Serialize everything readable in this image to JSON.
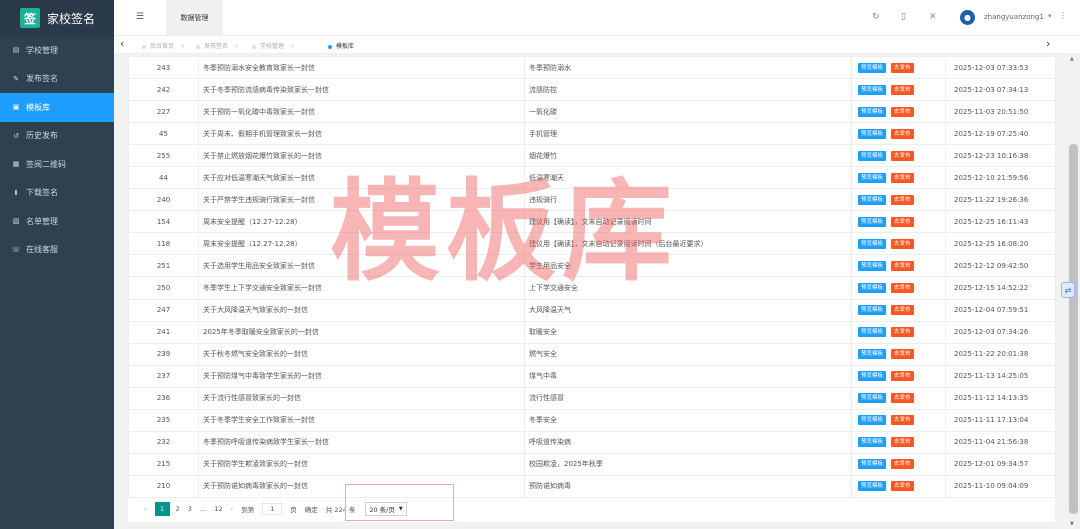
{
  "app": {
    "logo_char": "签",
    "title": "家校签名"
  },
  "sidebar": {
    "items": [
      {
        "label": "学校管理",
        "icon": "document-icon"
      },
      {
        "label": "发布签名",
        "icon": "pencil-icon"
      },
      {
        "label": "模板库",
        "icon": "file-icon",
        "active": true
      },
      {
        "label": "历史发布",
        "icon": "history-icon"
      },
      {
        "label": "签阅二维码",
        "icon": "qrcode-icon"
      },
      {
        "label": "下载签名",
        "icon": "download-icon"
      },
      {
        "label": "名单管理",
        "icon": "contacts-icon"
      },
      {
        "label": "在线客服",
        "icon": "customer-service-icon"
      }
    ]
  },
  "topbar": {
    "top_tab": "数据管理",
    "username": "zhangyuanzong1"
  },
  "tabs": [
    {
      "label": "后台首页"
    },
    {
      "label": "发布签名"
    },
    {
      "label": "学校管理"
    },
    {
      "label": "模板库",
      "current": true
    }
  ],
  "table": {
    "preview_label": "预览模板",
    "publish_label": "去发布",
    "rows": [
      {
        "id": "243",
        "title": "冬季预防溺水安全教育致家长一封信",
        "category": "冬季预防溺水",
        "time": "2025-12-03 07:33:53"
      },
      {
        "id": "242",
        "title": "关于冬季预防流感病毒传染致家长一封信",
        "category": "流感防控",
        "time": "2025-12-03 07:34:13"
      },
      {
        "id": "227",
        "title": "关于预防一氧化碳中毒致家长一封信",
        "category": "一氧化碳",
        "time": "2025-11-03 20:51:50"
      },
      {
        "id": "45",
        "title": "关于周末、假期手机管理致家长一封信",
        "category": "手机管理",
        "time": "2025-12-19 07:25:40"
      },
      {
        "id": "255",
        "title": "关于禁止燃放烟花爆竹致家长的一封信",
        "category": "烟花爆竹",
        "time": "2025-12-23 10:16:38"
      },
      {
        "id": "44",
        "title": "关于应对低温寒潮天气致家长一封信",
        "category": "低温寒潮天",
        "time": "2025-12-10 21:59:56"
      },
      {
        "id": "240",
        "title": "关于严禁学生违规骑行致家长一封信",
        "category": "违规骑行",
        "time": "2025-11-22 19:26:36"
      },
      {
        "id": "154",
        "title": "周末安全提醒（12.27-12.28）",
        "category": "建议用【确读】，文末自动记录阅读时间",
        "time": "2025-12-25 16:11:43"
      },
      {
        "id": "118",
        "title": "周末安全提醒（12.27-12.28）",
        "category": "建议用【确读】，文末自动记录阅读时间（后台最近要求）",
        "time": "2025-12-25 16:08:20"
      },
      {
        "id": "251",
        "title": "关于选用学生用品安全致家长一封信",
        "category": "学生用品安全",
        "time": "2025-12-12 09:42:50"
      },
      {
        "id": "250",
        "title": "冬季学生上下学交通安全致家长一封信",
        "category": "上下学交通安全",
        "time": "2025-12-15 14:52:22"
      },
      {
        "id": "247",
        "title": "关于大风降温天气致家长的一封信",
        "category": "大风降温天气",
        "time": "2025-12-04 07:59:51"
      },
      {
        "id": "241",
        "title": "2025年冬季取暖安全致家长的一封信",
        "category": "取暖安全",
        "time": "2025-12-03 07:34:26"
      },
      {
        "id": "239",
        "title": "关于秋冬燃气安全致家长的一封信",
        "category": "燃气安全",
        "time": "2025-11-22 20:01:38"
      },
      {
        "id": "237",
        "title": "关于预防煤气中毒致学生家长的一封信",
        "category": "煤气中毒",
        "time": "2025-11-13 14:25:05"
      },
      {
        "id": "236",
        "title": "关于流行性感冒致家长的一封信",
        "category": "流行性感冒",
        "time": "2025-11-12 14:13:35"
      },
      {
        "id": "235",
        "title": "关于冬季学生安全工作致家长一封信",
        "category": "冬季安全",
        "time": "2025-11-11 17:13:04"
      },
      {
        "id": "232",
        "title": "冬季预防呼吸道传染病致学生家长一封信",
        "category": "呼吸道传染病",
        "time": "2025-11-04 21:56:38"
      },
      {
        "id": "215",
        "title": "关于预防学生欺凌致家长的一封信",
        "category": "校园欺凌，2025年秋季",
        "time": "2025-12-01 09:34:57"
      },
      {
        "id": "210",
        "title": "关于预防诺如病毒致家长的一封信",
        "category": "预防诺如病毒",
        "time": "2025-11-10 09:04:09"
      }
    ]
  },
  "pagination": {
    "prev": "‹",
    "p1": "1",
    "p2": "2",
    "p3": "3",
    "ellipsis": "…",
    "last": "12",
    "next": "›",
    "goto_label": "到第",
    "page_value": "1",
    "page_unit": "页",
    "confirm": "确定",
    "total": "共 224 条",
    "page_size": "20 条/页"
  },
  "watermark": "模板库",
  "colors": {
    "sidebar_bg": "#2f4050",
    "active": "#1e9fff",
    "logo": "#1ab394",
    "preview_btn": "#1e9fff",
    "publish_btn": "#ff5722",
    "pager_current": "#009688"
  }
}
